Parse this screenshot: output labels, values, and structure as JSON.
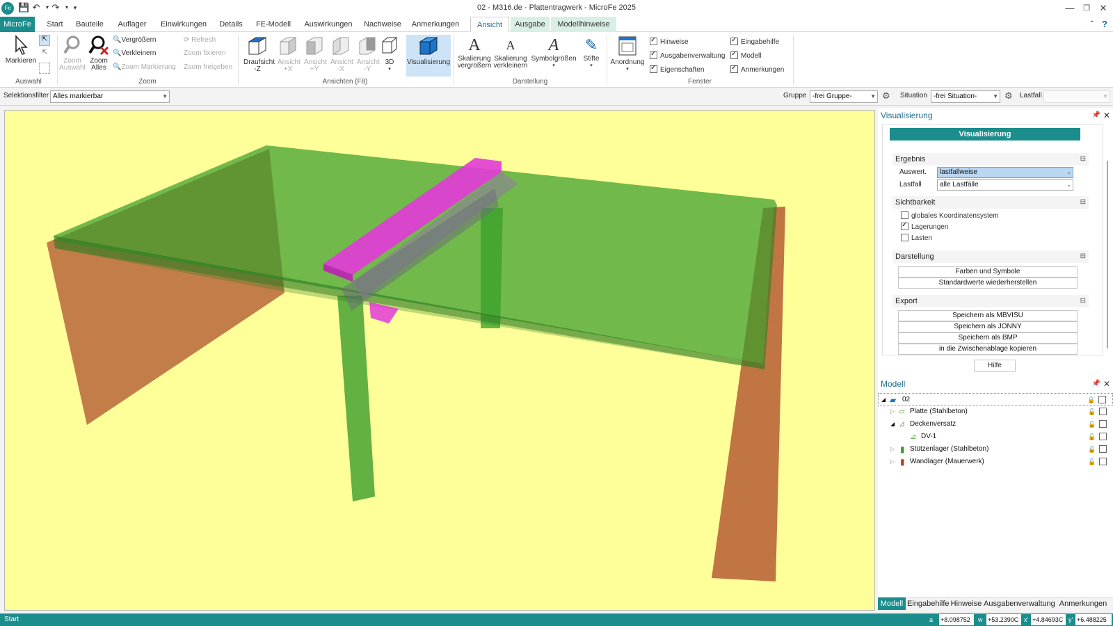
{
  "window": {
    "title": "02 - M316.de - Plattentragwerk - MicroFe 2025",
    "app_icon": "microfe-logo-icon"
  },
  "menu": {
    "file_tab": "MicroFe",
    "tabs": [
      "Start",
      "Bauteile",
      "Auflager",
      "Einwirkungen",
      "Details",
      "FE-Modell",
      "Auswirkungen",
      "Nachweise",
      "Anmerkungen",
      "Ansicht",
      "Ausgabe",
      "Modellhinweise"
    ],
    "active_tab": "Ansicht"
  },
  "ribbon": {
    "auswahl": {
      "label": "Auswahl",
      "markieren": "Markieren"
    },
    "zoom": {
      "label": "Zoom",
      "zoom_auswahl": "Zoom Auswahl",
      "zoom_alles": "Zoom Alles",
      "vergroessern": "Vergrößern",
      "verkleinern": "Verkleinern",
      "zoom_markierung": "Zoom Markierung",
      "refresh": "Refresh",
      "zoom_fixieren": "Zoom fixieren",
      "zoom_freigeben": "Zoom freigeben"
    },
    "ansichten": {
      "label": "Ansichten (F8)",
      "draufsicht": "Draufsicht -Z",
      "ansicht_px": "Ansicht +X",
      "ansicht_py": "Ansicht +Y",
      "ansicht_mx": "Ansicht -X",
      "ansicht_my": "Ansicht -Y",
      "d3": "3D",
      "visualisierung": "Visualisierung"
    },
    "darstellung": {
      "label": "Darstellung",
      "skal_vergr": "Skalierung vergrößern",
      "skal_verkl": "Skalierung verkleinern",
      "symbolgroessen": "Symbolgrößen",
      "stifte": "Stifte"
    },
    "fenster": {
      "label": "Fenster",
      "anordnung": "Anordnung",
      "hinweise": "Hinweise",
      "ausgabenverwaltung": "Ausgabenverwaltung",
      "eigenschaften": "Eigenschaften",
      "eingabehilfe": "Eingabehilfe",
      "modell": "Modell",
      "anmerkungen": "Anmerkungen"
    }
  },
  "filterbar": {
    "selektionsfilter_label": "Selektionsfilter",
    "selektionsfilter_value": "Alles markierbar",
    "gruppe_label": "Gruppe",
    "gruppe_value": "-frei Gruppe-",
    "situation_label": "Situation",
    "situation_value": "-frei Situation-",
    "lastfall_label": "Lastfall",
    "lastfall_value": ""
  },
  "visualisierung": {
    "panel_title": "Visualisierung",
    "header_button": "Visualisierung",
    "ergebnis": {
      "title": "Ergebnis",
      "auswert_label": "Auswert.",
      "auswert_value": "lastfallweise",
      "lastfall_label": "Lastfall",
      "lastfall_value": "alle Lastfälle"
    },
    "sichtbarkeit": {
      "title": "Sichtbarkeit",
      "items": [
        {
          "label": "globales Koordinatensystem",
          "checked": false
        },
        {
          "label": "Lagerungen",
          "checked": true
        },
        {
          "label": "Lasten",
          "checked": false
        }
      ]
    },
    "darstellung": {
      "title": "Darstellung",
      "farben": "Farben und Symbole",
      "standard": "Standardwerte wiederherstellen"
    },
    "export": {
      "title": "Export",
      "mbvisu": "Speichern als MBVISU",
      "jonny": "Speichern als JONNY",
      "bmp": "Speichern als BMP",
      "clipboard": "in die Zwischenablage kopieren"
    },
    "hilfe": "Hilfe"
  },
  "modell": {
    "panel_title": "Modell",
    "root": "02",
    "items": [
      {
        "label": "Platte (Stahlbeton)",
        "level": 1
      },
      {
        "label": "Deckenversatz",
        "level": 1
      },
      {
        "label": "DV-1",
        "level": 2
      },
      {
        "label": "Stützenlager (Stahlbeton)",
        "level": 1
      },
      {
        "label": "Wandlager (Mauerwerk)",
        "level": 1
      }
    ]
  },
  "bottom_tabs": [
    "Modell",
    "Eingabehilfe",
    "Hinweise",
    "Ausgabenverwaltung",
    "Anmerkungen"
  ],
  "status": {
    "text": "Start",
    "a_label": "a",
    "a_value": "+8.098752",
    "w_label": "w",
    "w_value": "+53.2390C",
    "x_label": "x'",
    "x_value": "+4.84693C",
    "y_label": "y'",
    "y_value": "+6.488225"
  },
  "colors": {
    "accent": "#1b8d8c",
    "viewport_bg": "#ffff99",
    "slab": "#3c9e2c",
    "wall": "#b9663a",
    "beam": "#e23ad9"
  }
}
